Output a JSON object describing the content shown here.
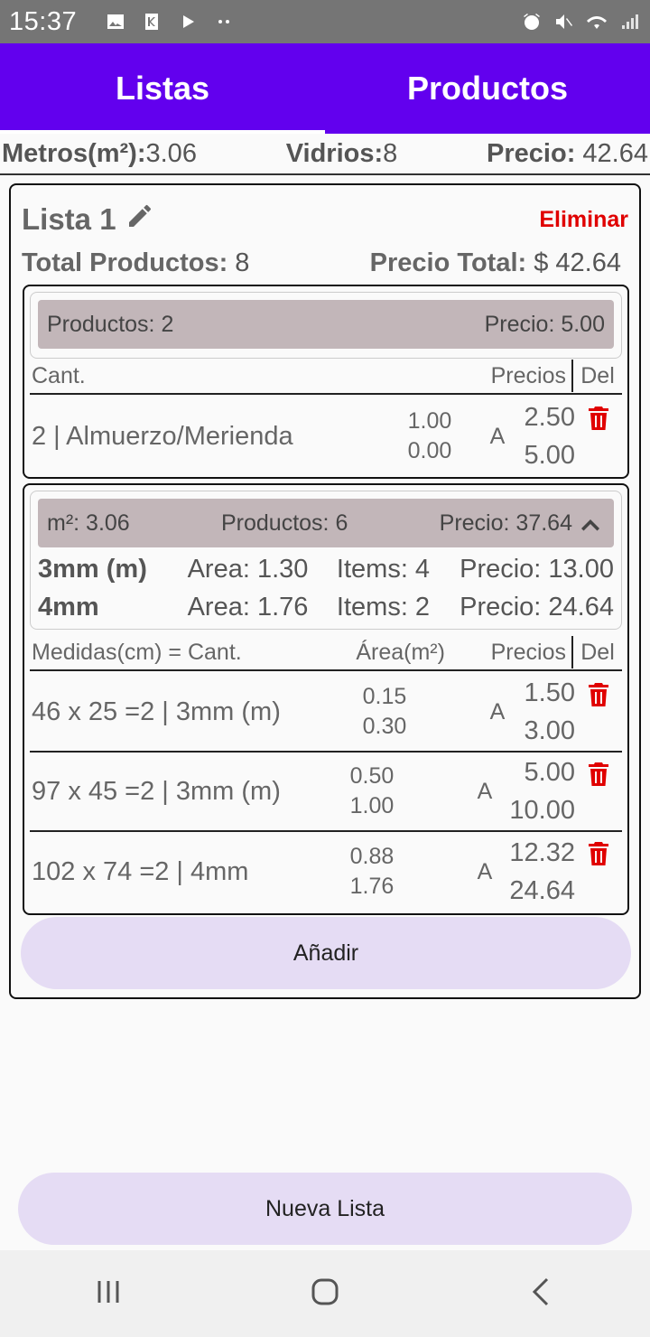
{
  "status_bar": {
    "time": "15:37"
  },
  "tabs": [
    {
      "label": "Listas",
      "active": true
    },
    {
      "label": "Productos",
      "active": false
    }
  ],
  "summary": {
    "metros_label": "Metros(m²):",
    "metros_value": "3.06",
    "vidrios_label": "Vidrios:",
    "vidrios_value": "8",
    "precio_label": "Precio:",
    "precio_value": " 42.64"
  },
  "list": {
    "title": "Lista 1",
    "delete_label": "Eliminar",
    "total_products_label": "Total Productos:",
    "total_products_value": " 8",
    "total_price_label": "Precio Total:",
    "total_price_value": " $ 42.64",
    "group1": {
      "header_products": "Productos: 2",
      "header_price": "Precio: 5.00",
      "col_qty": "Cant.",
      "col_prices": "Precios",
      "col_del": "Del",
      "rows": [
        {
          "label": "2 | Almuerzo/Merienda",
          "a1": "1.00",
          "a2": "0.00",
          "letter": "A",
          "p1": "2.50",
          "p2": "5.00"
        }
      ]
    },
    "group2": {
      "header_m2": "m²: 3.06",
      "header_products": "Productos: 6",
      "header_price": "Precio: 37.64",
      "thickness": [
        {
          "name": "3mm (m)",
          "area": "Area: 1.30",
          "items": "Items: 4",
          "price": "Precio: 13.00"
        },
        {
          "name": "4mm",
          "area": "Area: 1.76",
          "items": "Items: 2",
          "price": "Precio: 24.64"
        }
      ],
      "col_measures": "Medidas(cm) = Cant.",
      "col_area": "Área(m²)",
      "col_prices": "Precios",
      "col_del": "Del",
      "rows": [
        {
          "label": "46 x 25 =2 | 3mm (m)",
          "a1": "0.15",
          "a2": "0.30",
          "letter": "A",
          "p1": "1.50",
          "p2": "3.00"
        },
        {
          "label": "97 x 45 =2 | 3mm (m)",
          "a1": "0.50",
          "a2": "1.00",
          "letter": "A",
          "p1": "5.00",
          "p2": "10.00"
        },
        {
          "label": "102 x 74 =2 | 4mm",
          "a1": "0.88",
          "a2": "1.76",
          "letter": "A",
          "p1": "12.32",
          "p2": "24.64"
        }
      ]
    },
    "add_button": "Añadir"
  },
  "new_list_button": "Nueva Lista",
  "colors": {
    "primary": "#6200ee",
    "danger": "#e00000",
    "button_bg": "#e5dcf4",
    "group_header": "#c2b6b9"
  }
}
